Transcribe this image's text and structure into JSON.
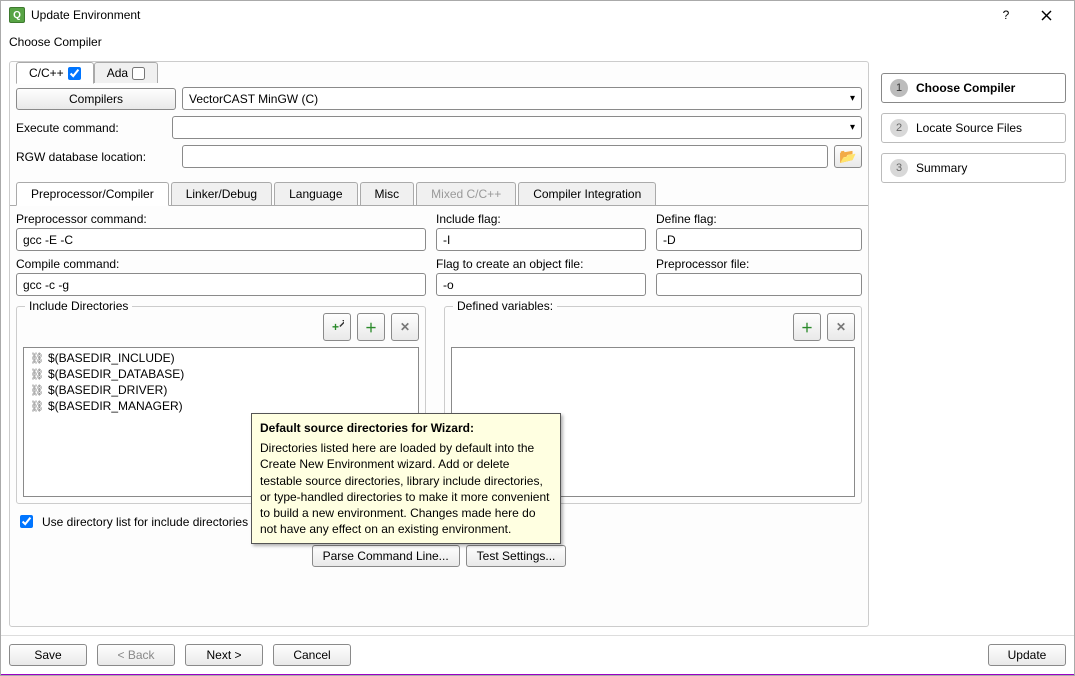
{
  "window": {
    "title": "Update Environment",
    "subtitle": "Choose Compiler"
  },
  "langTabs": [
    {
      "label": "C/C++",
      "checked": true,
      "active": true
    },
    {
      "label": "Ada",
      "checked": false,
      "active": false
    }
  ],
  "compilers_button": "Compilers",
  "compiler_dropdown": "VectorCAST MinGW (C)",
  "execute_cmd": {
    "label": "Execute command:",
    "value": ""
  },
  "rgw": {
    "label": "RGW database location:",
    "value": ""
  },
  "subTabs": [
    {
      "label": "Preprocessor/Compiler",
      "active": true
    },
    {
      "label": "Linker/Debug"
    },
    {
      "label": "Language"
    },
    {
      "label": "Misc"
    },
    {
      "label": "Mixed C/C++",
      "disabled": true
    },
    {
      "label": "Compiler Integration"
    }
  ],
  "preproc": {
    "labels": {
      "pre_cmd": "Preprocessor command:",
      "include_flag": "Include flag:",
      "define_flag": "Define flag:",
      "compile_cmd": "Compile command:",
      "objfile_flag": "Flag to create an object file:",
      "pre_file": "Preprocessor file:"
    },
    "pre_cmd": "gcc -E -C",
    "include_flag": "-I",
    "define_flag": "-D",
    "compile_cmd": "gcc -c -g",
    "objfile_flag": "-o",
    "pre_file": ""
  },
  "includeDirs": {
    "legend": "Include Directories",
    "items": [
      "$(BASEDIR_INCLUDE)",
      "$(BASEDIR_DATABASE)",
      "$(BASEDIR_DRIVER)",
      "$(BASEDIR_MANAGER)"
    ]
  },
  "definedVars": {
    "legend": "Defined variables:",
    "items": []
  },
  "useDirList": {
    "label": "Use directory list for include directories",
    "checked": true
  },
  "center_buttons": {
    "parse": "Parse Command Line...",
    "test": "Test Settings..."
  },
  "steps": [
    {
      "num": "1",
      "label": "Choose Compiler",
      "active": true
    },
    {
      "num": "2",
      "label": "Locate Source Files"
    },
    {
      "num": "3",
      "label": "Summary"
    }
  ],
  "bottom": {
    "save": "Save",
    "back": "< Back",
    "next": "Next >",
    "cancel": "Cancel",
    "update": "Update"
  },
  "tooltip": {
    "title": "Default source directories for Wizard:",
    "body": "Directories listed here are loaded by default into the Create New Environment wizard. Add or delete testable source directories, library include directories, or type-handled directories to make it more convenient to build a new environment. Changes made here do not have any effect on an existing environment."
  }
}
